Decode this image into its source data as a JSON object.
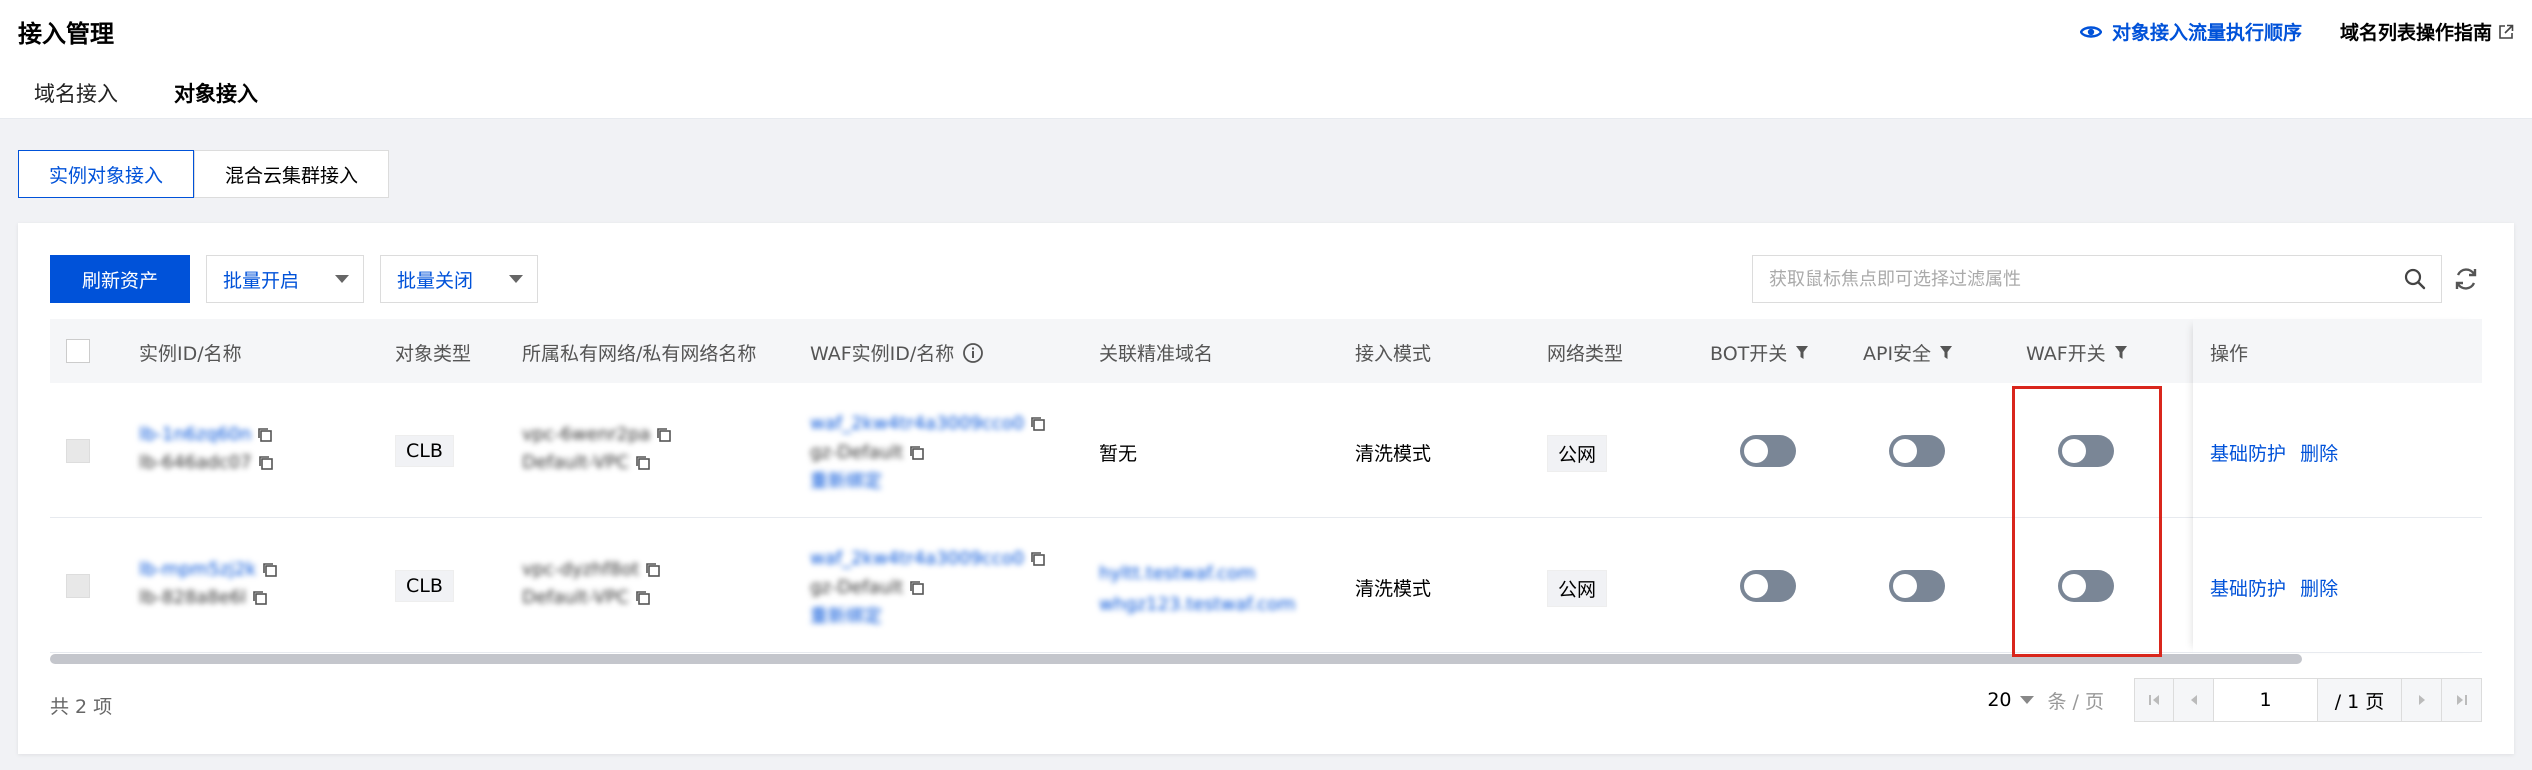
{
  "header": {
    "title": "接入管理",
    "link_flow": "对象接入流量执行顺序",
    "link_guide": "域名列表操作指南",
    "tabs": [
      "域名接入",
      "对象接入"
    ],
    "active_tab": 1
  },
  "segment": {
    "items": [
      "实例对象接入",
      "混合云集群接入"
    ],
    "active": 0
  },
  "toolbar": {
    "refresh_label": "刷新资产",
    "batch_on": "批量开启",
    "batch_off": "批量关闭",
    "search_placeholder": "获取鼠标焦点即可选择过滤属性"
  },
  "table": {
    "columns": {
      "instance": "实例ID/名称",
      "type": "对象类型",
      "vpc": "所属私有网络/私有网络名称",
      "waf": "WAF实例ID/名称",
      "domain": "关联精准域名",
      "mode": "接入模式",
      "network": "网络类型",
      "bot": "BOT开关",
      "api": "API安全",
      "waf_switch": "WAF开关",
      "ops": "操作"
    },
    "rows": [
      {
        "instance_id": "lb-1n6zq60n",
        "instance_name": "lb-646adc07",
        "type": "CLB",
        "vpc_id": "vpc-6wenr2pa",
        "vpc_name": "Default-VPC",
        "waf_id": "waf_2kw4tr4a3009cco0",
        "waf_name": "gz-Default",
        "waf_rebind": "重新绑定",
        "domain_empty": "暂无",
        "domains": [],
        "mode": "清洗模式",
        "network": "公网",
        "bot_on": false,
        "api_on": false,
        "waf_on": false,
        "op_basic": "基础防护",
        "op_delete": "删除"
      },
      {
        "instance_id": "lb-mpm5zj2k",
        "instance_name": "lb-828a8e6l",
        "type": "CLB",
        "vpc_id": "vpc-dyzhf8ot",
        "vpc_name": "Default-VPC",
        "waf_id": "waf_2kw4tr4a3009cco0",
        "waf_name": "gz-Default",
        "waf_rebind": "重新绑定",
        "domain_empty": "",
        "domains": [
          "hyltt.testwaf.com",
          "whgz123.testwaf.com"
        ],
        "mode": "清洗模式",
        "network": "公网",
        "bot_on": false,
        "api_on": false,
        "waf_on": false,
        "op_basic": "基础防护",
        "op_delete": "删除"
      }
    ]
  },
  "footer": {
    "total": "共 2 项",
    "page_size": "20",
    "page_unit": "条 / 页",
    "current_page": "1",
    "total_pages": "/ 1 页"
  },
  "colors": {
    "primary": "#0052d9",
    "highlight": "#d9261c",
    "toggle_off": "#7a8696"
  }
}
